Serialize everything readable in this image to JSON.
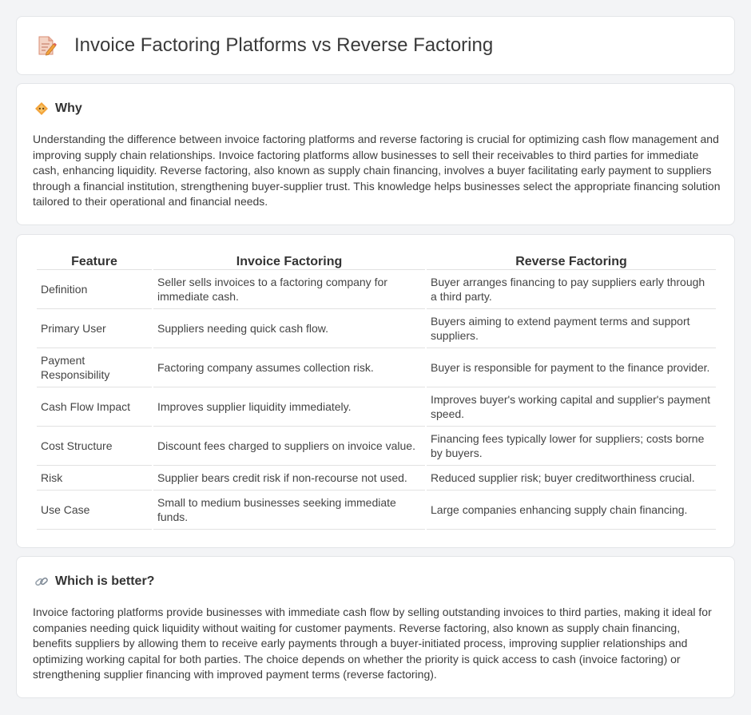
{
  "header": {
    "title": "Invoice Factoring Platforms vs Reverse Factoring",
    "icon": "document-edit-icon"
  },
  "why": {
    "heading": "Why",
    "icon": "diamond-bullet-icon",
    "text": "Understanding the difference between invoice factoring platforms and reverse factoring is crucial for optimizing cash flow management and improving supply chain relationships. Invoice factoring platforms allow businesses to sell their receivables to third parties for immediate cash, enhancing liquidity. Reverse factoring, also known as supply chain financing, involves a buyer facilitating early payment to suppliers through a financial institution, strengthening buyer-supplier trust. This knowledge helps businesses select the appropriate financing solution tailored to their operational and financial needs."
  },
  "table": {
    "headers": [
      "Feature",
      "Invoice Factoring",
      "Reverse Factoring"
    ],
    "rows": [
      [
        "Definition",
        "Seller sells invoices to a factoring company for immediate cash.",
        "Buyer arranges financing to pay suppliers early through a third party."
      ],
      [
        "Primary User",
        "Suppliers needing quick cash flow.",
        "Buyers aiming to extend payment terms and support suppliers."
      ],
      [
        "Payment Responsibility",
        "Factoring company assumes collection risk.",
        "Buyer is responsible for payment to the finance provider."
      ],
      [
        "Cash Flow Impact",
        "Improves supplier liquidity immediately.",
        "Improves buyer's working capital and supplier's payment speed."
      ],
      [
        "Cost Structure",
        "Discount fees charged to suppliers on invoice value.",
        "Financing fees typically lower for suppliers; costs borne by buyers."
      ],
      [
        "Risk",
        "Supplier bears credit risk if non-recourse not used.",
        "Reduced supplier risk; buyer creditworthiness crucial."
      ],
      [
        "Use Case",
        "Small to medium businesses seeking immediate funds.",
        "Large companies enhancing supply chain financing."
      ]
    ]
  },
  "better": {
    "heading": "Which is better?",
    "icon": "link-icon",
    "text": "Invoice factoring platforms provide businesses with immediate cash flow by selling outstanding invoices to third parties, making it ideal for companies needing quick liquidity without waiting for customer payments. Reverse factoring, also known as supply chain financing, benefits suppliers by allowing them to receive early payments through a buyer-initiated process, improving supplier relationships and optimizing working capital for both parties. The choice depends on whether the priority is quick access to cash (invoice factoring) or strengthening supplier financing with improved payment terms (reverse factoring)."
  }
}
